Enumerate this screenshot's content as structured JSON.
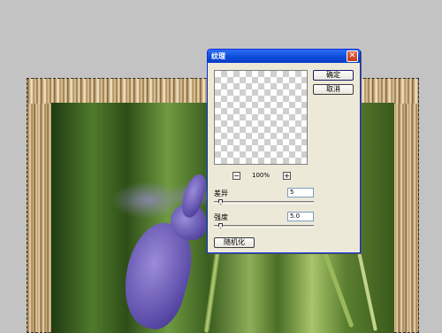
{
  "dialog": {
    "title": "纹理",
    "close_glyph": "✕",
    "ok_label": "确定",
    "cancel_label": "取消",
    "zoom": {
      "minus_glyph": "−",
      "plus_glyph": "+",
      "level": "100%"
    },
    "difference": {
      "label": "差异",
      "value": "5"
    },
    "strength": {
      "label": "强度",
      "value": "5.0"
    },
    "randomize_label": "随机化"
  }
}
